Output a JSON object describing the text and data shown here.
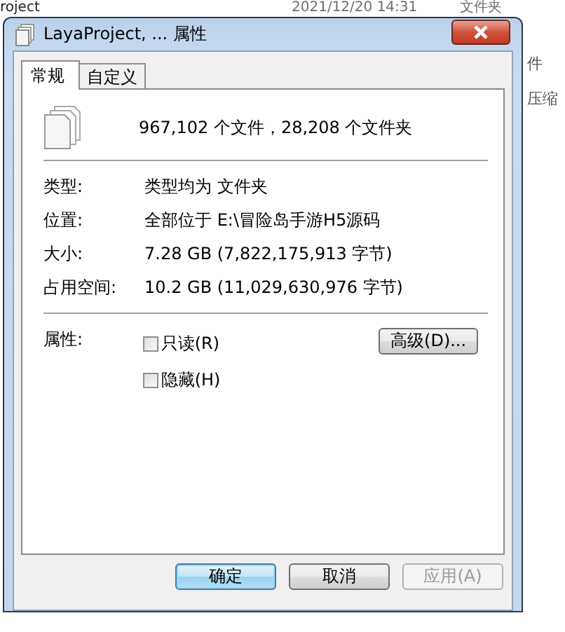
{
  "background": {
    "top_row": {
      "column_1": "roject",
      "column_2": "2021/12/20 14:31",
      "column_3": "文件夹"
    },
    "side_texts": [
      "件",
      "压缩"
    ]
  },
  "window": {
    "title": "LayaProject, ... 属性"
  },
  "tabs": [
    {
      "label": "常规",
      "selected": true
    },
    {
      "label": "自定义",
      "selected": false
    }
  ],
  "summary": "967,102 个文件，28,208 个文件夹",
  "properties": [
    {
      "label": "类型:",
      "value": "类型均为 文件夹"
    },
    {
      "label": "位置:",
      "value": "全部位于 E:\\冒险岛手游H5源码"
    },
    {
      "label": "大小:",
      "value": "7.28 GB (7,822,175,913 字节)"
    },
    {
      "label": "占用空间:",
      "value": "10.2 GB (11,029,630,976 字节)"
    }
  ],
  "attributes": {
    "label": "属性:",
    "checkboxes": [
      {
        "label": "只读(R)",
        "checked": false
      },
      {
        "label": "隐藏(H)",
        "checked": false
      }
    ],
    "advanced_button": "高级(D)..."
  },
  "buttons": [
    {
      "label": "确定",
      "default": true,
      "disabled": false
    },
    {
      "label": "取消",
      "default": false,
      "disabled": false
    },
    {
      "label": "应用(A)",
      "default": false,
      "disabled": true
    }
  ]
}
